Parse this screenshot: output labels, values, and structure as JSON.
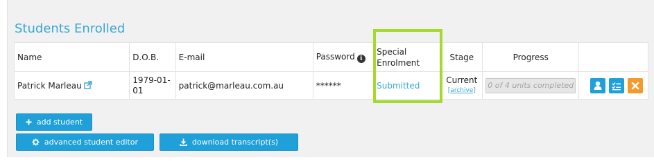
{
  "section": {
    "title": "Students Enrolled"
  },
  "table": {
    "headers": {
      "name": "Name",
      "dob": "D.O.B.",
      "email": "E-mail",
      "password": "Password",
      "special_line1": "Special",
      "special_line2": "Enrolment",
      "stage": "Stage",
      "progress": "Progress"
    },
    "rows": [
      {
        "name": "Patrick Marleau",
        "dob_line1": "1979-01-",
        "dob_line2": "01",
        "email": "patrick@marleau.com.au",
        "password": "******",
        "special": "Submitted",
        "stage": "Current",
        "archive_label": "archive",
        "progress": "0 of 4 units completed"
      }
    ]
  },
  "buttons": {
    "add_student": "add student",
    "advanced_editor": "advanced student editor",
    "download_transcript": "download transcript(s)"
  },
  "colors": {
    "accent": "#1fa0d8",
    "title": "#3aa7d6",
    "highlight": "#a5d92b",
    "delete": "#f39a2a"
  }
}
